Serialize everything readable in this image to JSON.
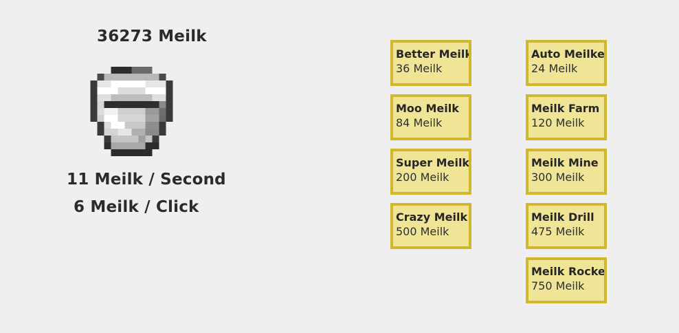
{
  "counter": {
    "total": "36273 Meilk",
    "per_second": "11 Meilk / Second",
    "per_click": "6 Meilk / Click"
  },
  "bucket_icon": "milk-bucket-icon",
  "upgrades_left": [
    {
      "name": "Better Meilk",
      "cost": "36 Meilk"
    },
    {
      "name": "Moo Meilk",
      "cost": "84 Meilk"
    },
    {
      "name": "Super Meilk",
      "cost": "200 Meilk"
    },
    {
      "name": "Crazy Meilk",
      "cost": "500 Meilk"
    }
  ],
  "upgrades_right": [
    {
      "name": "Auto Meilker",
      "cost": "24 Meilk"
    },
    {
      "name": "Meilk Farm",
      "cost": "120 Meilk"
    },
    {
      "name": "Meilk Mine",
      "cost": "300 Meilk"
    },
    {
      "name": "Meilk Drill",
      "cost": "475 Meilk"
    },
    {
      "name": "Meilk Rocket",
      "cost": "750 Meilk"
    }
  ],
  "colors": {
    "background": "#efefef",
    "card_fill": "#f0e597",
    "card_border": "#d0b82e",
    "text": "#2b2b2b"
  }
}
